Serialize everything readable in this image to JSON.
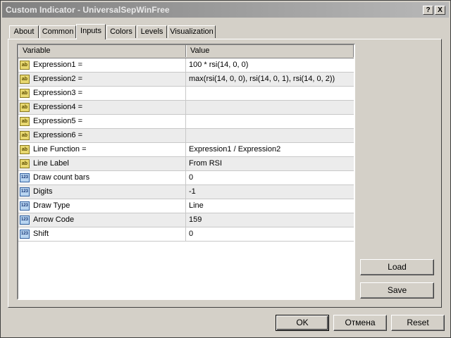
{
  "window": {
    "title": "Custom Indicator - UniversalSepWinFree",
    "help_label": "?",
    "close_label": "X"
  },
  "tabs": [
    {
      "label": "About"
    },
    {
      "label": "Common"
    },
    {
      "label": "Inputs",
      "active": true
    },
    {
      "label": "Colors"
    },
    {
      "label": "Levels"
    },
    {
      "label": "Visualization"
    }
  ],
  "grid": {
    "headers": {
      "variable": "Variable",
      "value": "Value"
    },
    "icon_text": {
      "ab": "ab",
      "num": "123"
    },
    "rows": [
      {
        "icon": "ab",
        "variable": "Expression1 =",
        "value": "100 * rsi(14, 0, 0)"
      },
      {
        "icon": "ab",
        "variable": "Expression2 =",
        "value": "max(rsi(14, 0, 0), rsi(14, 0, 1), rsi(14, 0, 2))"
      },
      {
        "icon": "ab",
        "variable": "Expression3 =",
        "value": ""
      },
      {
        "icon": "ab",
        "variable": "Expression4 =",
        "value": ""
      },
      {
        "icon": "ab",
        "variable": "Expression5 =",
        "value": ""
      },
      {
        "icon": "ab",
        "variable": "Expression6 =",
        "value": ""
      },
      {
        "icon": "ab",
        "variable": "Line Function =",
        "value": "Expression1 / Expression2"
      },
      {
        "icon": "ab",
        "variable": "Line Label",
        "value": "From RSI"
      },
      {
        "icon": "num",
        "variable": "Draw count bars",
        "value": "0"
      },
      {
        "icon": "num",
        "variable": "Digits",
        "value": "-1"
      },
      {
        "icon": "num",
        "variable": "Draw Type",
        "value": "Line"
      },
      {
        "icon": "num",
        "variable": "Arrow Code",
        "value": "159"
      },
      {
        "icon": "num",
        "variable": "Shift",
        "value": "0"
      }
    ]
  },
  "buttons": {
    "load": "Load",
    "save": "Save",
    "ok": "OK",
    "cancel": "Отмена",
    "reset": "Reset"
  }
}
